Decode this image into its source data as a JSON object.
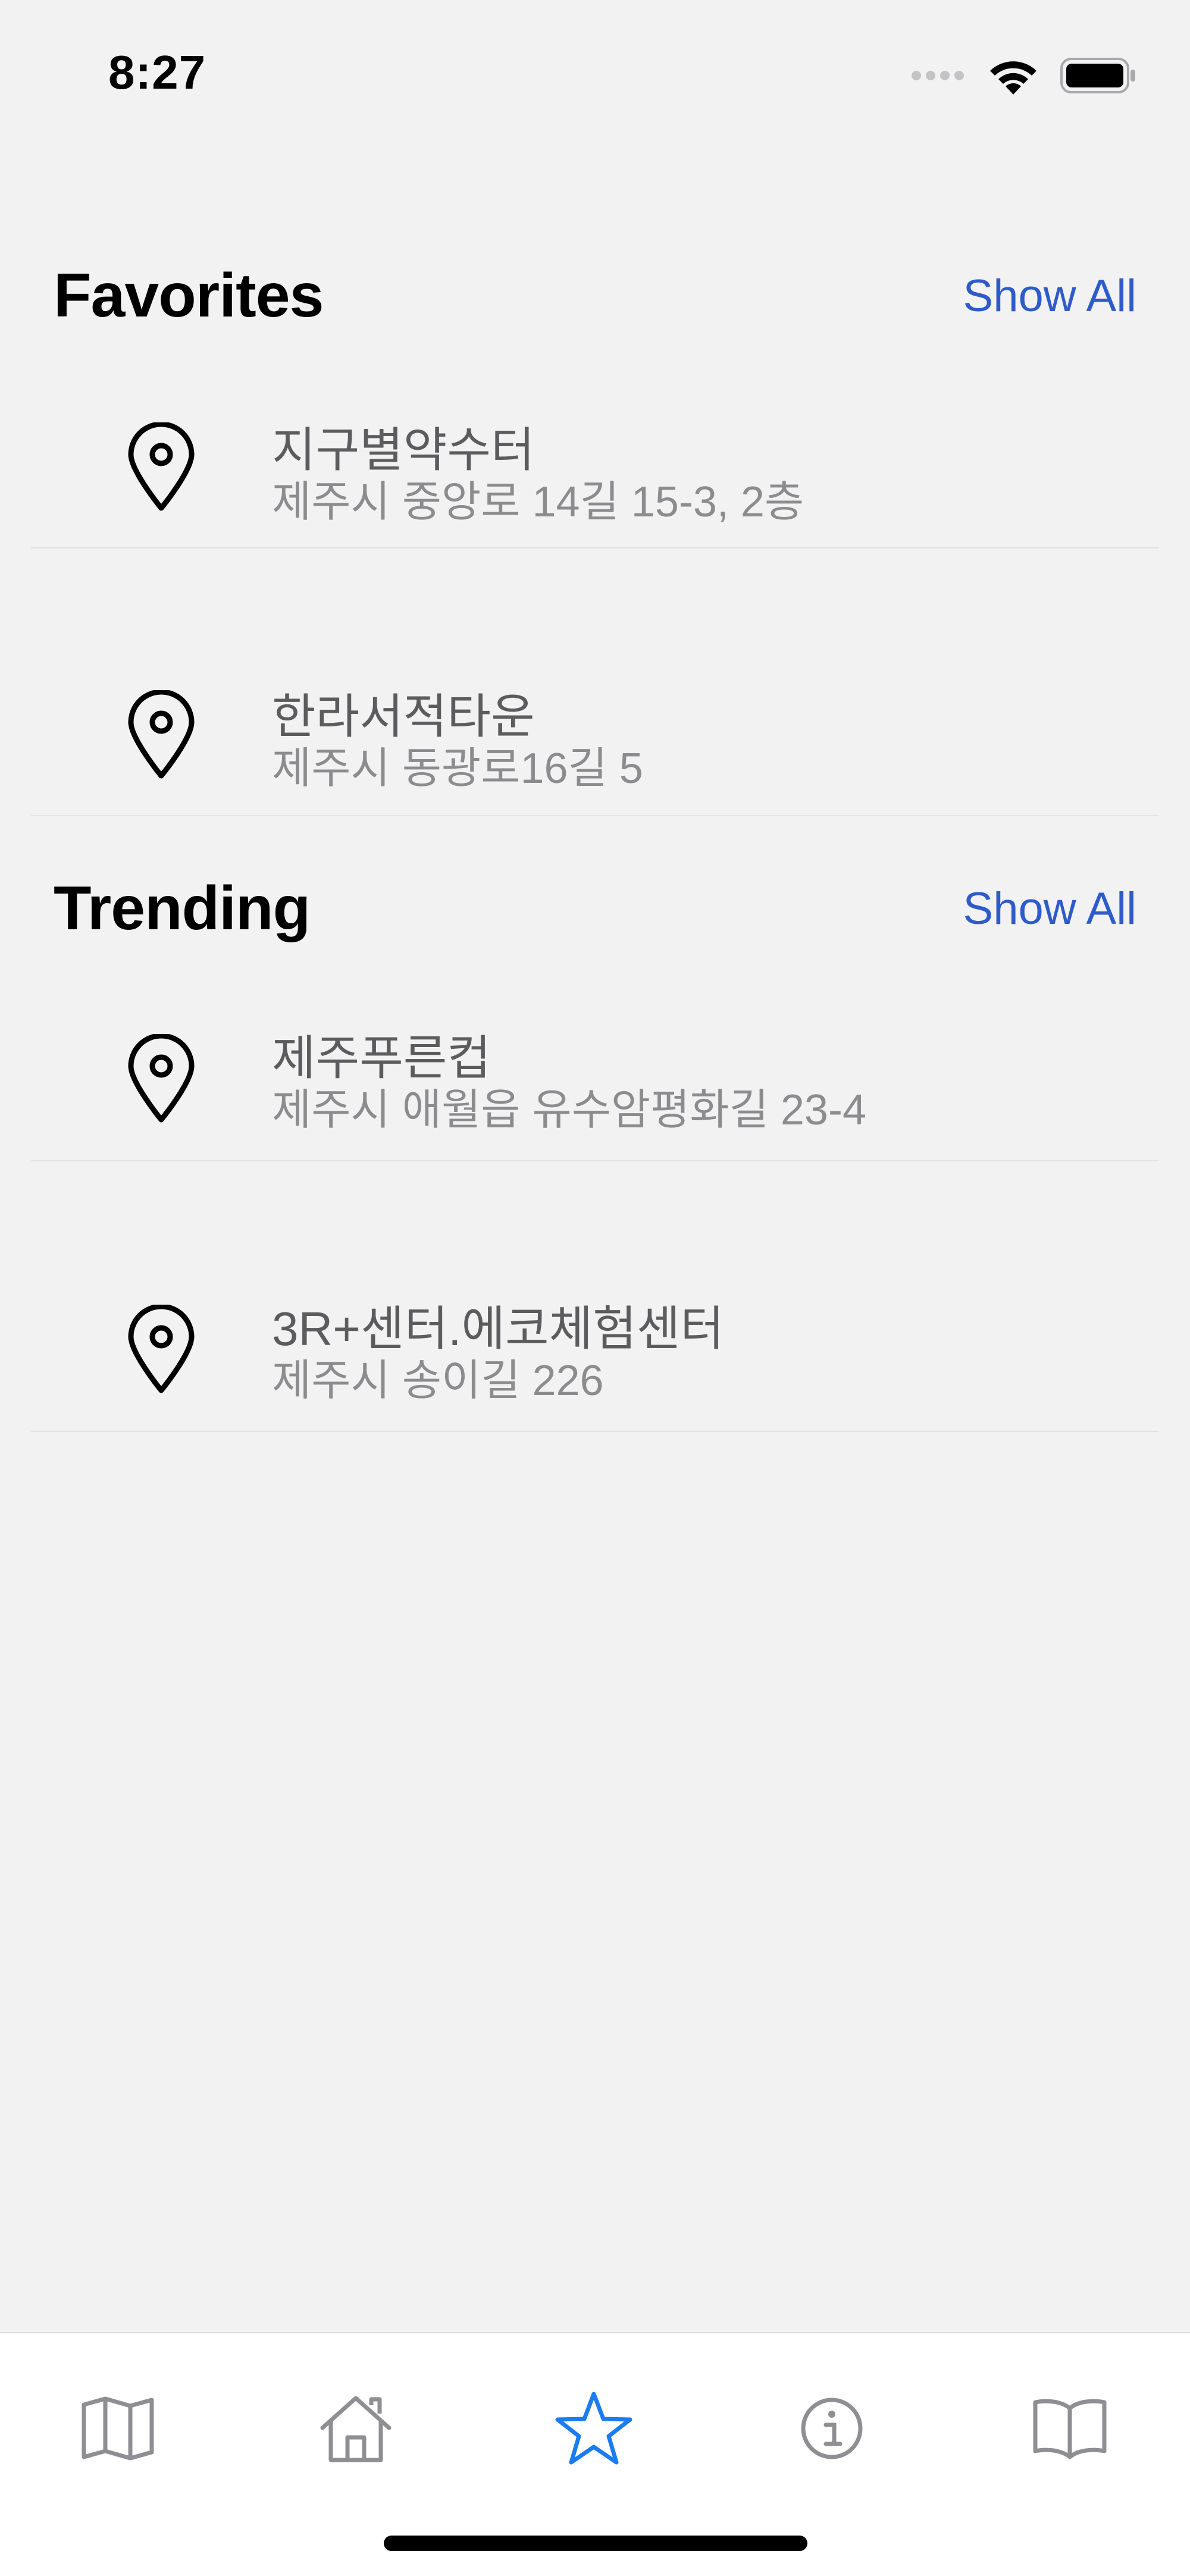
{
  "status_bar": {
    "time": "8:27"
  },
  "favorites": {
    "title": "Favorites",
    "show_all_label": "Show All",
    "items": [
      {
        "name": "지구별약수터",
        "address": "제주시 중앙로 14길 15-3, 2층",
        "icon": "map-pin-icon"
      },
      {
        "name": "한라서적타운",
        "address": "제주시  동광로16길 5",
        "icon": "map-pin-icon"
      }
    ]
  },
  "trending": {
    "title": "Trending",
    "show_all_label": "Show All",
    "items": [
      {
        "name": "제주푸른컵",
        "address": "제주시 애월읍 유수암평화길 23-4",
        "icon": "map-pin-icon"
      },
      {
        "name": "3R+센터.에코체험센터",
        "address": "제주시 송이길 226",
        "icon": "map-pin-icon"
      }
    ]
  },
  "tab_bar": {
    "tabs": [
      {
        "icon": "map-icon",
        "selected": false
      },
      {
        "icon": "house-icon",
        "selected": false
      },
      {
        "icon": "star-icon",
        "selected": true
      },
      {
        "icon": "info-icon",
        "selected": false
      },
      {
        "icon": "book-icon",
        "selected": false
      }
    ],
    "selected_color": "#1a7cf0",
    "unselected_color": "#8e8e93"
  },
  "colors": {
    "background": "#f2f2f3",
    "accent": "#2e5bc9"
  }
}
